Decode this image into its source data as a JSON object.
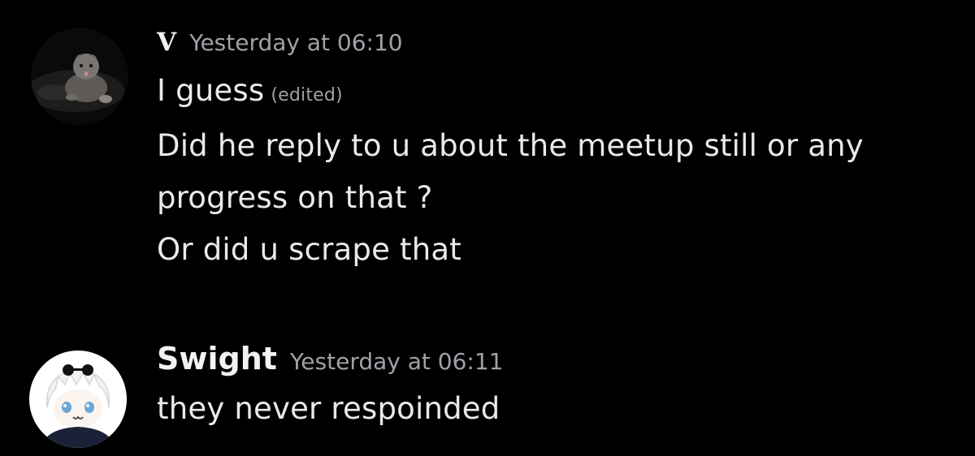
{
  "messages": [
    {
      "author": "V",
      "timestamp": "Yesterday at 06:10",
      "avatar_icon": "cat-avatar-icon",
      "lines": [
        {
          "text": "I guess",
          "edited_label": "(edited)"
        },
        {
          "text": "Did he reply to u about the meetup still or any"
        },
        {
          "text": "progress on that ?"
        },
        {
          "text": "Or did u scrape that"
        }
      ]
    },
    {
      "author": "Swight",
      "timestamp": "Yesterday at 06:11",
      "avatar_icon": "plush-character-avatar-icon",
      "lines": [
        {
          "text": "they never respoinded"
        }
      ]
    }
  ],
  "colors": {
    "background": "#000000",
    "message_text": "#e9e9e9",
    "timestamp": "#9ea2a8",
    "username": "#f2f2f2"
  }
}
